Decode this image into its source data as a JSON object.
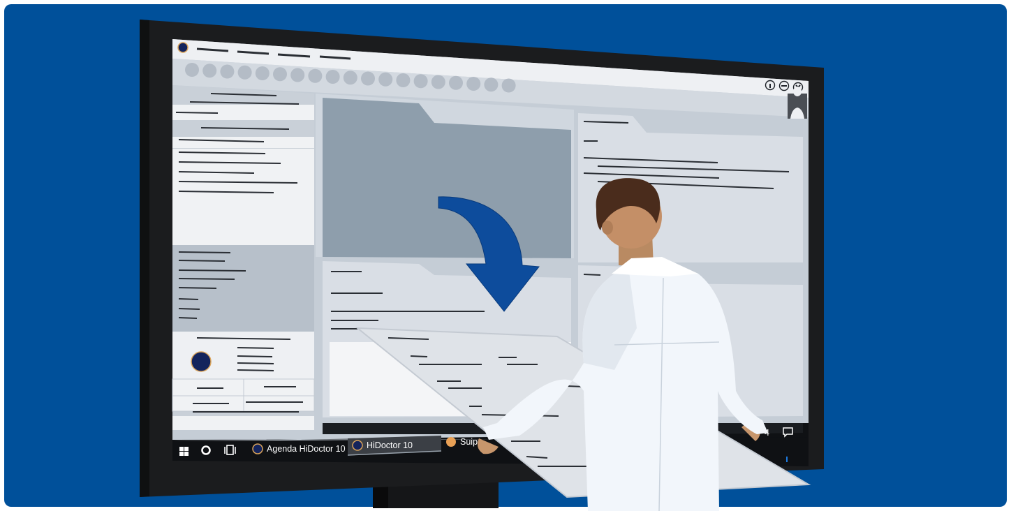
{
  "colors": {
    "backdrop": "#00509a",
    "monitor_bezel": "#1b1c1e",
    "taskbar": "#0f1114",
    "accent_navy": "#14245c",
    "arrow": "#0d4c9c",
    "app_icon_orange": "#e8a055"
  },
  "window": {
    "title_controls": [
      "info-icon",
      "minimize-icon",
      "close-icon"
    ],
    "avatar": "user-silhouette-icon"
  },
  "taskbar": {
    "start_icon": "windows-start-icon",
    "search_icon": "cortana-circle-icon",
    "task_view_icon": "task-view-icon",
    "apps": [
      {
        "label": "Agenda HiDoctor 10",
        "icon": "hidoctor-icon",
        "active": false
      },
      {
        "label": "HiDoctor 10",
        "icon": "hidoctor-icon",
        "active": true
      },
      {
        "label": "Suips",
        "icon": "orange-app-icon",
        "active": false
      }
    ],
    "clock_fragment": "4",
    "notification_icon": "action-center-icon"
  },
  "illustration": {
    "arrow": "curved-down-arrow",
    "person": "doctor-in-white-coat"
  }
}
